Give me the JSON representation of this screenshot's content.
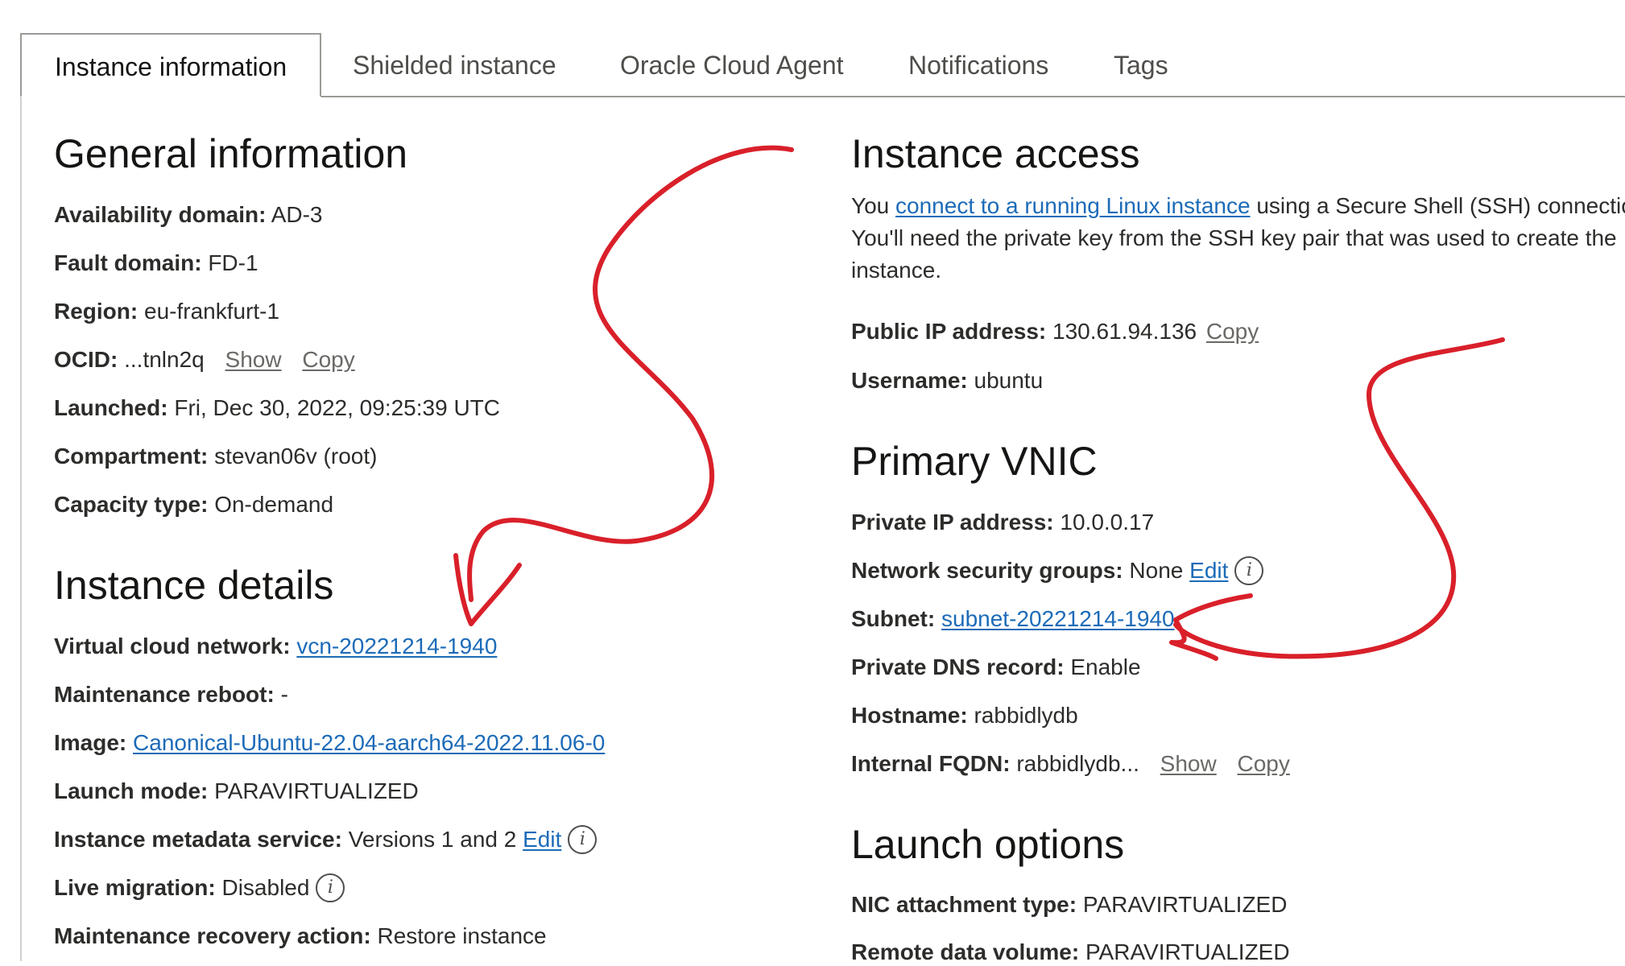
{
  "tabs": [
    {
      "label": "Instance information",
      "active": true
    },
    {
      "label": "Shielded instance"
    },
    {
      "label": "Oracle Cloud Agent"
    },
    {
      "label": "Notifications"
    },
    {
      "label": "Tags"
    }
  ],
  "general": {
    "title": "General information",
    "availability_label": "Availability domain:",
    "availability_value": "AD-3",
    "fault_label": "Fault domain:",
    "fault_value": "FD-1",
    "region_label": "Region:",
    "region_value": "eu-frankfurt-1",
    "ocid_label": "OCID:",
    "ocid_value": "...tnln2q",
    "ocid_show": "Show",
    "ocid_copy": "Copy",
    "launched_label": "Launched:",
    "launched_value": "Fri, Dec 30, 2022, 09:25:39 UTC",
    "compartment_label": "Compartment:",
    "compartment_value": "stevan06v (root)",
    "capacity_label": "Capacity type:",
    "capacity_value": "On-demand"
  },
  "details": {
    "title": "Instance details",
    "vcn_label": "Virtual cloud network:",
    "vcn_value": "vcn-20221214-1940",
    "reboot_label": "Maintenance reboot:",
    "reboot_value": "-",
    "image_label": "Image:",
    "image_value": "Canonical-Ubuntu-22.04-aarch64-2022.11.06-0",
    "launch_mode_label": "Launch mode:",
    "launch_mode_value": "PARAVIRTUALIZED",
    "imds_label": "Instance metadata service:",
    "imds_value": "Versions 1 and 2",
    "imds_edit": "Edit",
    "migration_label": "Live migration:",
    "migration_value": "Disabled",
    "recovery_label": "Maintenance recovery action:",
    "recovery_value": "Restore instance"
  },
  "access": {
    "title": "Instance access",
    "intro_before": "You ",
    "intro_link": "connect to a running Linux instance",
    "intro_after": " using a Secure Shell (SSH) connection. You'll need the private key from the SSH key pair that was used to create the instance.",
    "public_ip_label": "Public IP address:",
    "public_ip_value": "130.61.94.136",
    "public_ip_copy": "Copy",
    "username_label": "Username:",
    "username_value": "ubuntu"
  },
  "vnic": {
    "title": "Primary VNIC",
    "private_ip_label": "Private IP address:",
    "private_ip_value": "10.0.0.17",
    "nsg_label": "Network security groups:",
    "nsg_value": "None",
    "nsg_edit": "Edit",
    "subnet_label": "Subnet:",
    "subnet_value": "subnet-20221214-1940",
    "dns_label": "Private DNS record:",
    "dns_value": "Enable",
    "hostname_label": "Hostname:",
    "hostname_value": "rabbidlydb",
    "fqdn_label": "Internal FQDN:",
    "fqdn_value": "rabbidlydb...",
    "fqdn_show": "Show",
    "fqdn_copy": "Copy"
  },
  "launch": {
    "title": "Launch options",
    "nic_label": "NIC attachment type:",
    "nic_value": "PARAVIRTUALIZED",
    "remote_label": "Remote data volume:",
    "remote_value": "PARAVIRTUALIZED"
  },
  "colors": {
    "link": "#1c6bb8",
    "annotation": "#d9202a",
    "text": "#161513"
  },
  "info_icon_glyph": "i"
}
